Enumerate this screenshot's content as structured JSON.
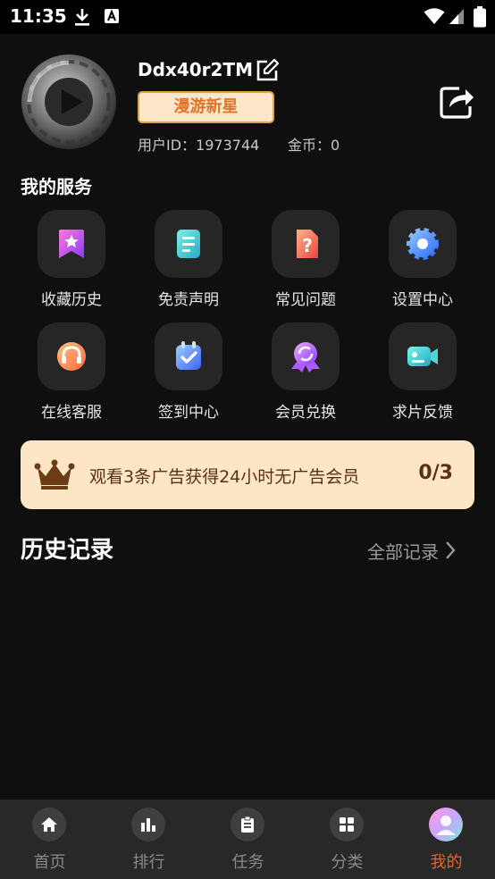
{
  "status_bar": {
    "time": "11:35"
  },
  "profile": {
    "username": "Ddx40r2TM",
    "level_badge": "漫游新星",
    "user_id": "用户ID：1973744",
    "coins": "金币：0"
  },
  "services": {
    "title": "我的服务",
    "items": [
      {
        "label": "收藏历史",
        "icon": "bookmark-star-icon"
      },
      {
        "label": "免责声明",
        "icon": "document-icon"
      },
      {
        "label": "常见问题",
        "icon": "question-icon"
      },
      {
        "label": "设置中心",
        "icon": "gear-icon"
      },
      {
        "label": "在线客服",
        "icon": "headset-icon"
      },
      {
        "label": "签到中心",
        "icon": "checkin-icon"
      },
      {
        "label": "会员兑换",
        "icon": "exchange-medal-icon"
      },
      {
        "label": "求片反馈",
        "icon": "video-camera-icon"
      }
    ]
  },
  "ad_banner": {
    "text": "观看3条广告获得24小时无广告会员",
    "progress": "0/3"
  },
  "history": {
    "title": "历史记录",
    "view_all": "全部记录"
  },
  "tabbar": {
    "items": [
      {
        "label": "首页",
        "icon": "home-icon"
      },
      {
        "label": "排行",
        "icon": "ranking-icon"
      },
      {
        "label": "任务",
        "icon": "task-clipboard-icon"
      },
      {
        "label": "分类",
        "icon": "category-grid-icon"
      },
      {
        "label": "我的",
        "icon": "profile-avatar-icon"
      }
    ],
    "active_index": 4
  },
  "colors": {
    "accent": "#e8622a",
    "background": "#0f0f0f",
    "banner_bg": "#fde6c6",
    "badge_border": "#e0a14a"
  }
}
